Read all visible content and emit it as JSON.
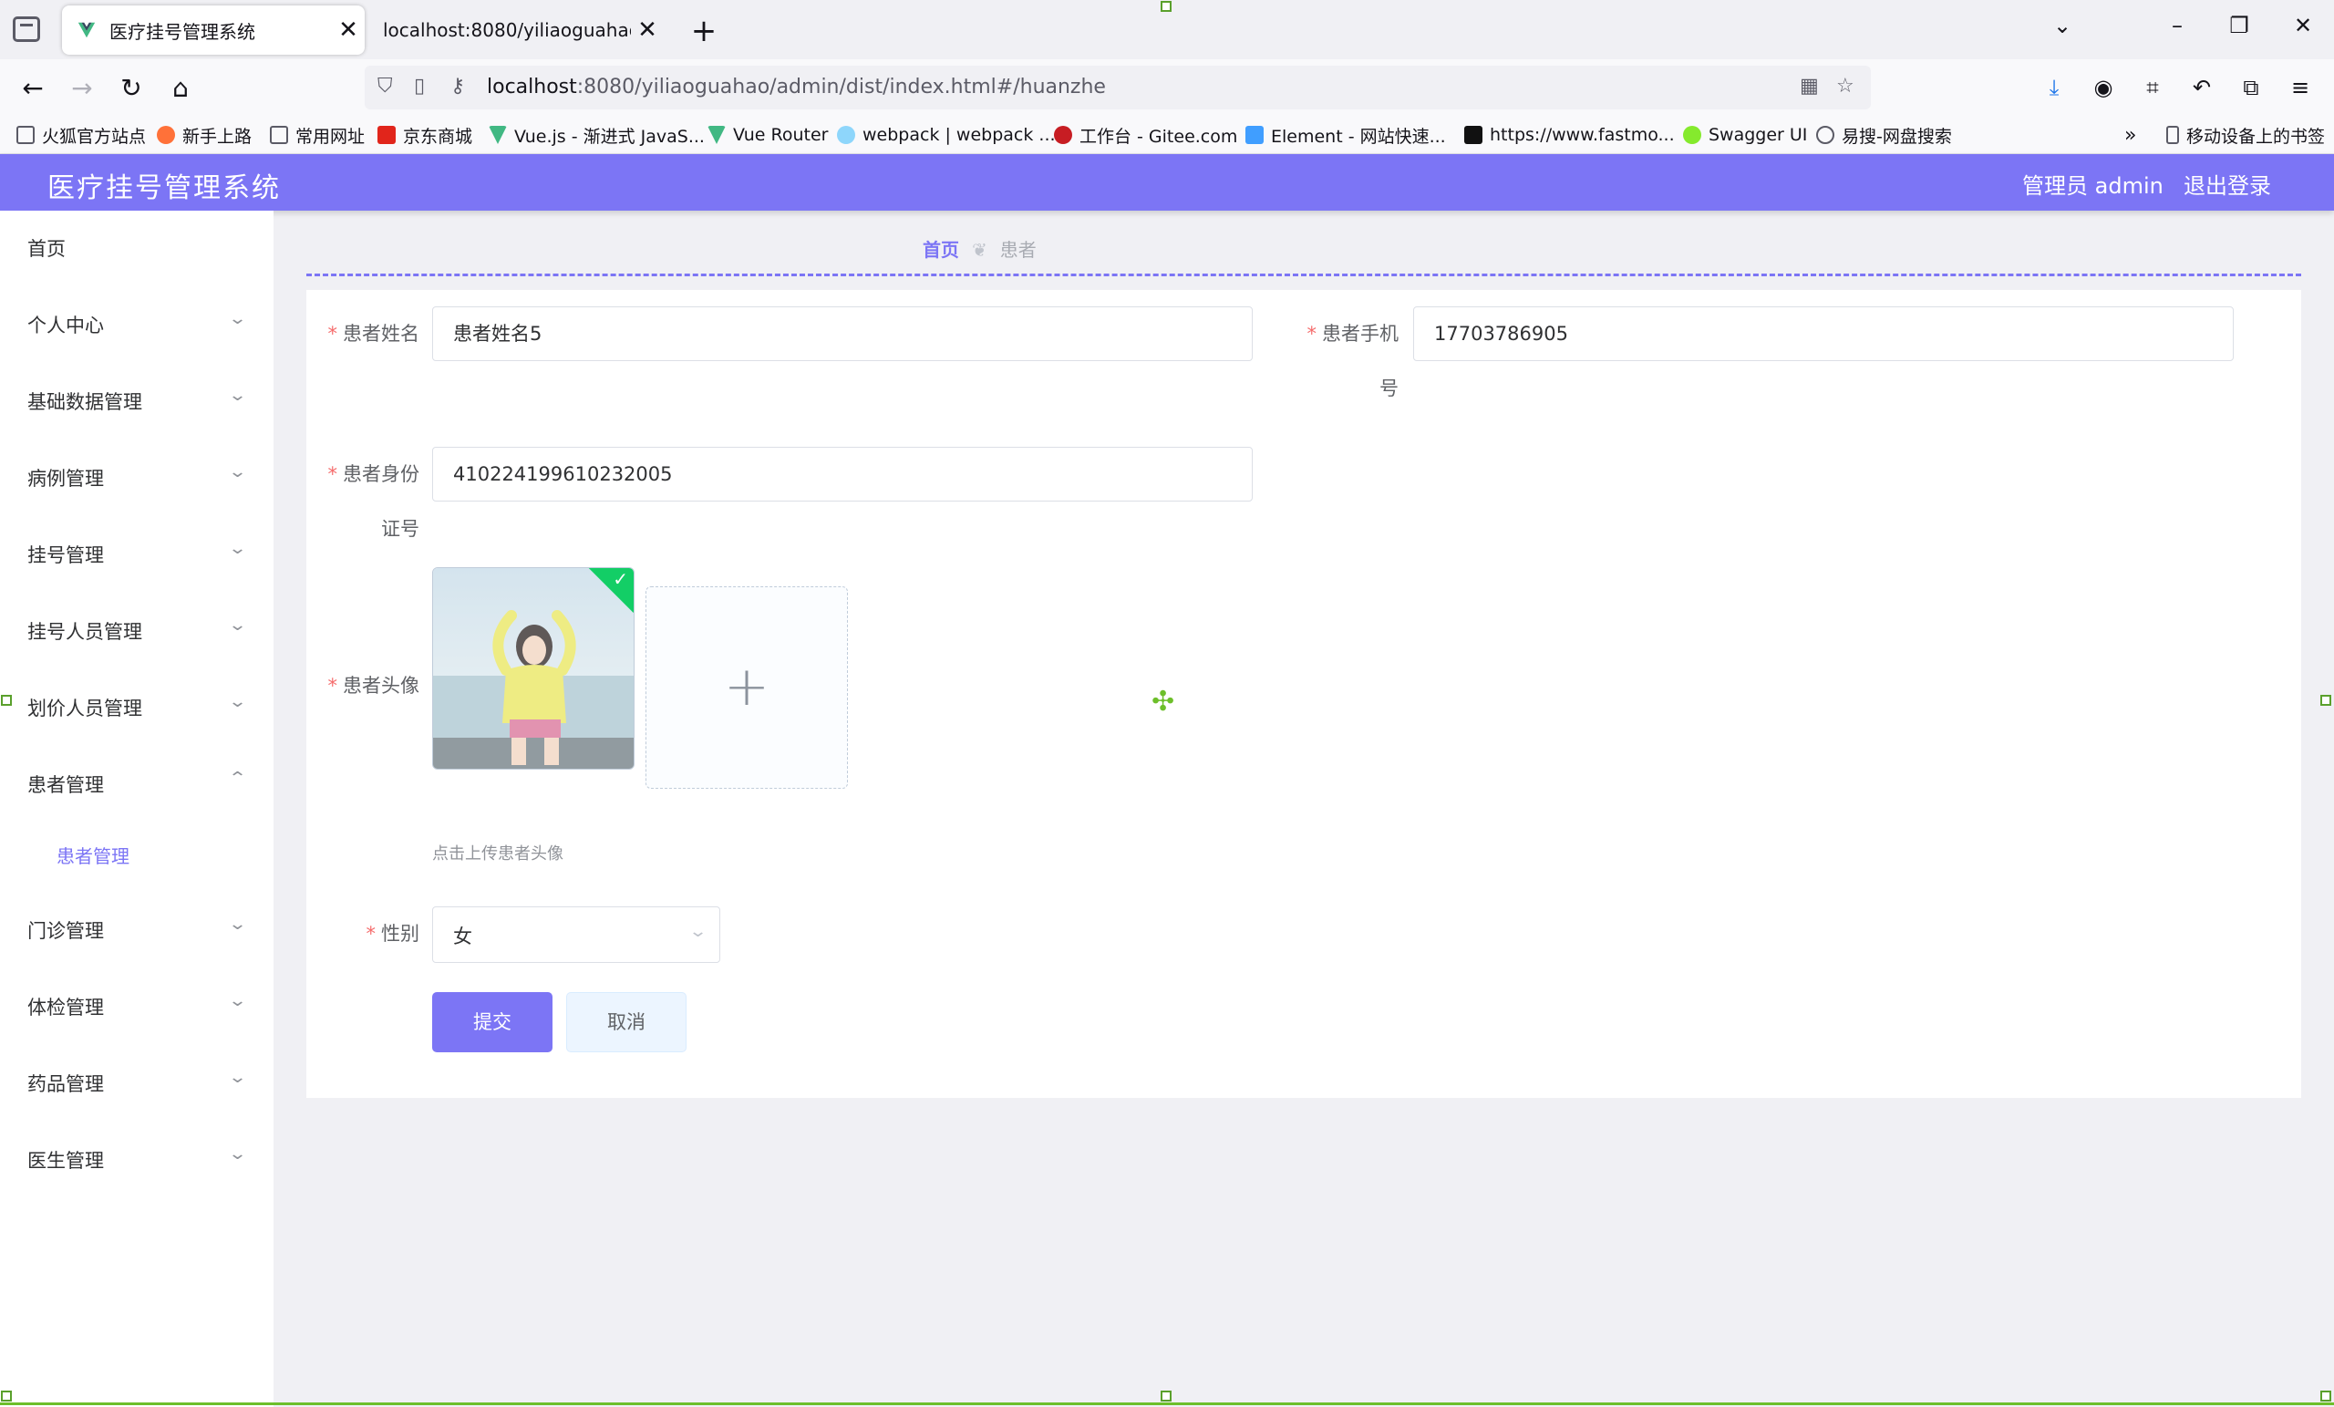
{
  "browser": {
    "tabs": [
      {
        "title": "医疗挂号管理系统",
        "active": true
      },
      {
        "title": "localhost:8080/yiliaoguahao/fron",
        "active": false
      }
    ],
    "url_host": "localhost",
    "url_rest": ":8080/yiliaoguahao/admin/dist/index.html#/huanzhe",
    "bookmarks": [
      "火狐官方站点",
      "新手上路",
      "常用网址",
      "京东商城",
      "Vue.js - 渐进式 JavaS...",
      "Vue Router",
      "webpack | webpack ...",
      "工作台 - Gitee.com",
      "Element - 网站快速...",
      "https://www.fastmo...",
      "Swagger UI",
      "易搜-网盘搜索",
      "移动设备上的书签"
    ]
  },
  "header": {
    "title": "医疗挂号管理系统",
    "user": "管理员 admin",
    "logout": "退出登录"
  },
  "sidebar": {
    "items": [
      {
        "label": "首页"
      },
      {
        "label": "个人中心"
      },
      {
        "label": "基础数据管理"
      },
      {
        "label": "病例管理"
      },
      {
        "label": "挂号管理"
      },
      {
        "label": "挂号人员管理"
      },
      {
        "label": "划价人员管理"
      },
      {
        "label": "患者管理"
      },
      {
        "label": "门诊管理"
      },
      {
        "label": "体检管理"
      },
      {
        "label": "药品管理"
      },
      {
        "label": "医生管理"
      }
    ],
    "sub_item": "患者管理"
  },
  "breadcrumb": {
    "home": "首页",
    "current": "患者"
  },
  "form": {
    "name_label": "患者姓名",
    "name_value": "患者姓名5",
    "phone_label_1": "患者手机",
    "phone_label_2": "号",
    "phone_value": "17703786905",
    "idcard_label_1": "患者身份",
    "idcard_label_2": "证号",
    "idcard_value": "410224199610232005",
    "avatar_label": "患者头像",
    "avatar_tip": "点击上传患者头像",
    "gender_label": "性别",
    "gender_value": "女",
    "submit": "提交",
    "cancel": "取消"
  },
  "colors": {
    "accent": "#7c75f5",
    "required": "#f56c6c"
  }
}
